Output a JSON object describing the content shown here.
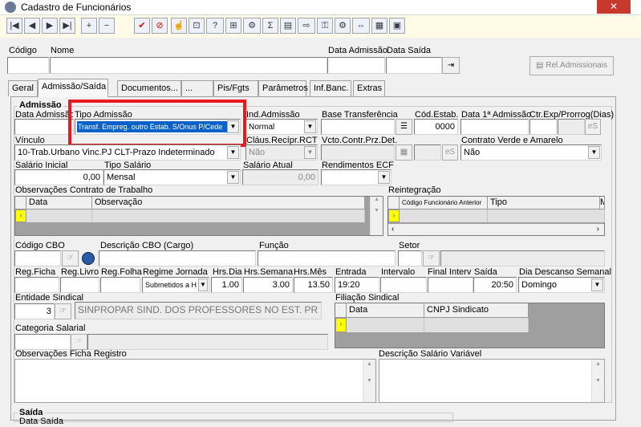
{
  "window": {
    "title": "Cadastro de Funcionários"
  },
  "toolbar": {
    "buttons": [
      "|◀",
      "◀",
      "▶",
      "▶|",
      "+",
      "−",
      "▲",
      "—",
      "✔",
      "⊘",
      "☝",
      "⊡",
      "?",
      "⊞",
      "⚙",
      "Σ",
      "▤",
      "⇨",
      "⚿",
      "⚙",
      "⇔",
      "▦",
      "▣"
    ]
  },
  "header": {
    "codigo_label": "Código",
    "nome_label": "Nome",
    "data_admissao_label": "Data Admissão",
    "data_saida_label": "Data Saída",
    "rel_button": "Rel.Admissionais"
  },
  "tabs": [
    "Geral",
    "Admissão/Saída",
    "Documentos...",
    "...",
    "Pis/Fgts",
    "Parâmetros",
    "Inf.Banc.",
    "Extras"
  ],
  "admissao": {
    "section_label": "Admissão",
    "data_admissao_label": "Data Admissão",
    "tipo_admissao_label": "Tipo Admissão",
    "tipo_admissao_value": "Transf. Empreg. outro Estab. S/Onus P/Cede",
    "ind_admissao_label": "Ind.Admissão",
    "ind_admissao_value": "Normal",
    "base_transf_label": "Base Transferência",
    "cod_estab_label": "Cód.Estab.",
    "cod_estab_value": "0000",
    "data_1a_label": "Data 1ª Admissão",
    "ctr_exp_label": "Ctr.Exp/Prorrog(Dias)",
    "es_label": "eS",
    "vinculo_label": "Vínculo",
    "vinculo_value": "10-Trab.Urbano Vinc.PJ CLT-Prazo Indeterminado",
    "claus_label": "Cláus.Recípr.RCT",
    "claus_value": "Não",
    "vcto_label": "Vcto.Contr.Prz.Det.",
    "contrato_verde_label": "Contrato Verde e Amarelo",
    "contrato_verde_value": "Não",
    "salario_inicial_label": "Salário Inicial",
    "salario_inicial_value": "0,00",
    "tipo_salario_label": "Tipo Salário",
    "tipo_salario_value": "Mensal",
    "salario_atual_label": "Salário Atual",
    "salario_atual_value": "0,00",
    "rendimentos_label": "Rendimentos ECF",
    "obs_contrato_label": "Observações Contrato de Trabalho",
    "obs_cols": [
      "Data",
      "Observação"
    ],
    "reintegracao_label": "Reintegração",
    "reint_cols": [
      "Código Funcionário Anterior",
      "Tipo",
      "M"
    ],
    "codigo_cbo_label": "Código CBO",
    "descricao_cbo_label": "Descrição CBO (Cargo)",
    "funcao_label": "Função",
    "setor_label": "Setor",
    "reg_ficha_label": "Reg.Ficha",
    "reg_livro_label": "Reg.Livro",
    "reg_folha_label": "Reg.Folha",
    "regime_label": "Regime Jornada",
    "regime_value": "Submetidos a H",
    "hrs_dia_label": "Hrs.Dia",
    "hrs_dia_value": "1.00",
    "hrs_semana_label": "Hrs.Semana",
    "hrs_semana_value": "3.00",
    "hrs_mes_label": "Hrs.Mês",
    "hrs_mes_value": "13.50",
    "entrada_label": "Entrada",
    "entrada_value": "19:20",
    "intervalo_label": "Intervalo",
    "final_interv_label": "Final Interv",
    "saida_label": "Saída",
    "saida_value": "20:50",
    "descanso_label": "Dia Descanso Semanal",
    "descanso_value": "Domingo",
    "entidade_label": "Entidade Sindical",
    "entidade_value": "3",
    "entidade_nome": "SINPROPAR SIND. DOS PROFESSORES NO EST. PR",
    "filiacao_label": "Filiação Sindical",
    "filiacao_cols": [
      "Data",
      "CNPJ Sindicato"
    ],
    "categoria_label": "Categoria Salarial",
    "obs_ficha_label": "Observações Ficha Registro",
    "desc_salario_label": "Descrição Salário Variável"
  },
  "saida": {
    "section_label": "Saída",
    "data_saida_label": "Data Saída"
  },
  "colors": {
    "highlight": "#e8191f",
    "selection": "#0a62c8",
    "indicator": "#ffff00"
  }
}
